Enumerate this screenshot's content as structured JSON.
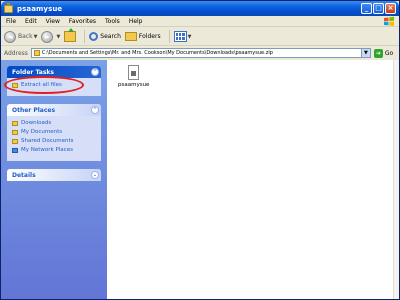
{
  "window": {
    "title": "psaamysue"
  },
  "menu": [
    "File",
    "Edit",
    "View",
    "Favorites",
    "Tools",
    "Help"
  ],
  "toolbar": {
    "back_label": "Back",
    "search_label": "Search",
    "folders_label": "Folders"
  },
  "address": {
    "label": "Address",
    "value": "C:\\Documents and Settings\\Mr. and Mrs. Cookson\\My Documents\\Downloads\\psaamysue.zip",
    "go_label": "Go"
  },
  "taskpane": {
    "folder_tasks": {
      "title": "Folder Tasks",
      "items": [
        "Extract all files"
      ]
    },
    "other_places": {
      "title": "Other Places",
      "items": [
        "Downloads",
        "My Documents",
        "Shared Documents",
        "My Network Places"
      ]
    },
    "details": {
      "title": "Details"
    }
  },
  "files": [
    {
      "name": "psaamysue"
    }
  ],
  "colors": {
    "highlight": "#e0201d",
    "titlebar": "#0550d0",
    "taskpane": "#6375d6"
  }
}
